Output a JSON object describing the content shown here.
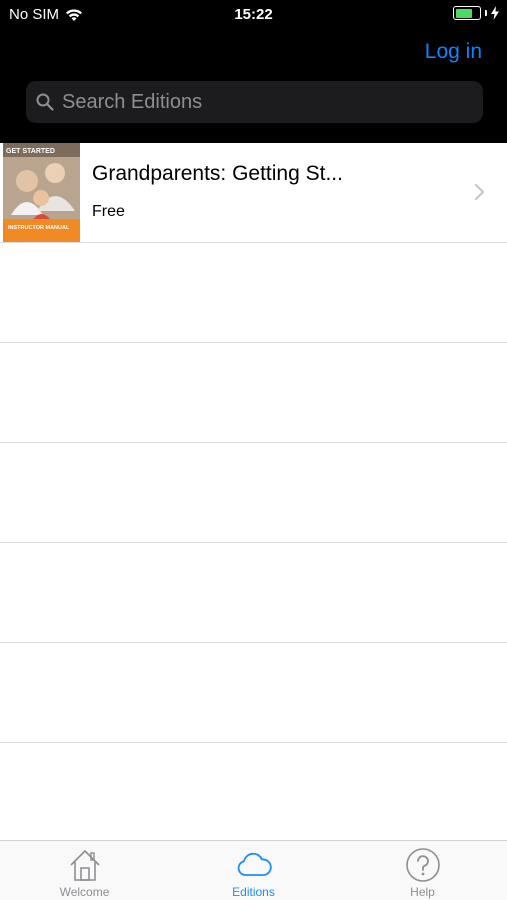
{
  "status": {
    "carrier": "No SIM",
    "time": "15:22"
  },
  "header": {
    "login_label": "Log in"
  },
  "search": {
    "placeholder": "Search Editions"
  },
  "editions": [
    {
      "title": "Grandparents: Getting St...",
      "price": "Free",
      "cover_text": "GET STARTED",
      "cover_sub": "INSTRUCTOR MANUAL"
    }
  ],
  "tabs": [
    {
      "label": "Welcome",
      "icon": "house-icon",
      "active": false
    },
    {
      "label": "Editions",
      "icon": "cloud-icon",
      "active": true
    },
    {
      "label": "Help",
      "icon": "question-icon",
      "active": false
    }
  ],
  "colors": {
    "accent": "#1e8ef6",
    "login": "#0a84ff",
    "battery": "#4cd964"
  }
}
